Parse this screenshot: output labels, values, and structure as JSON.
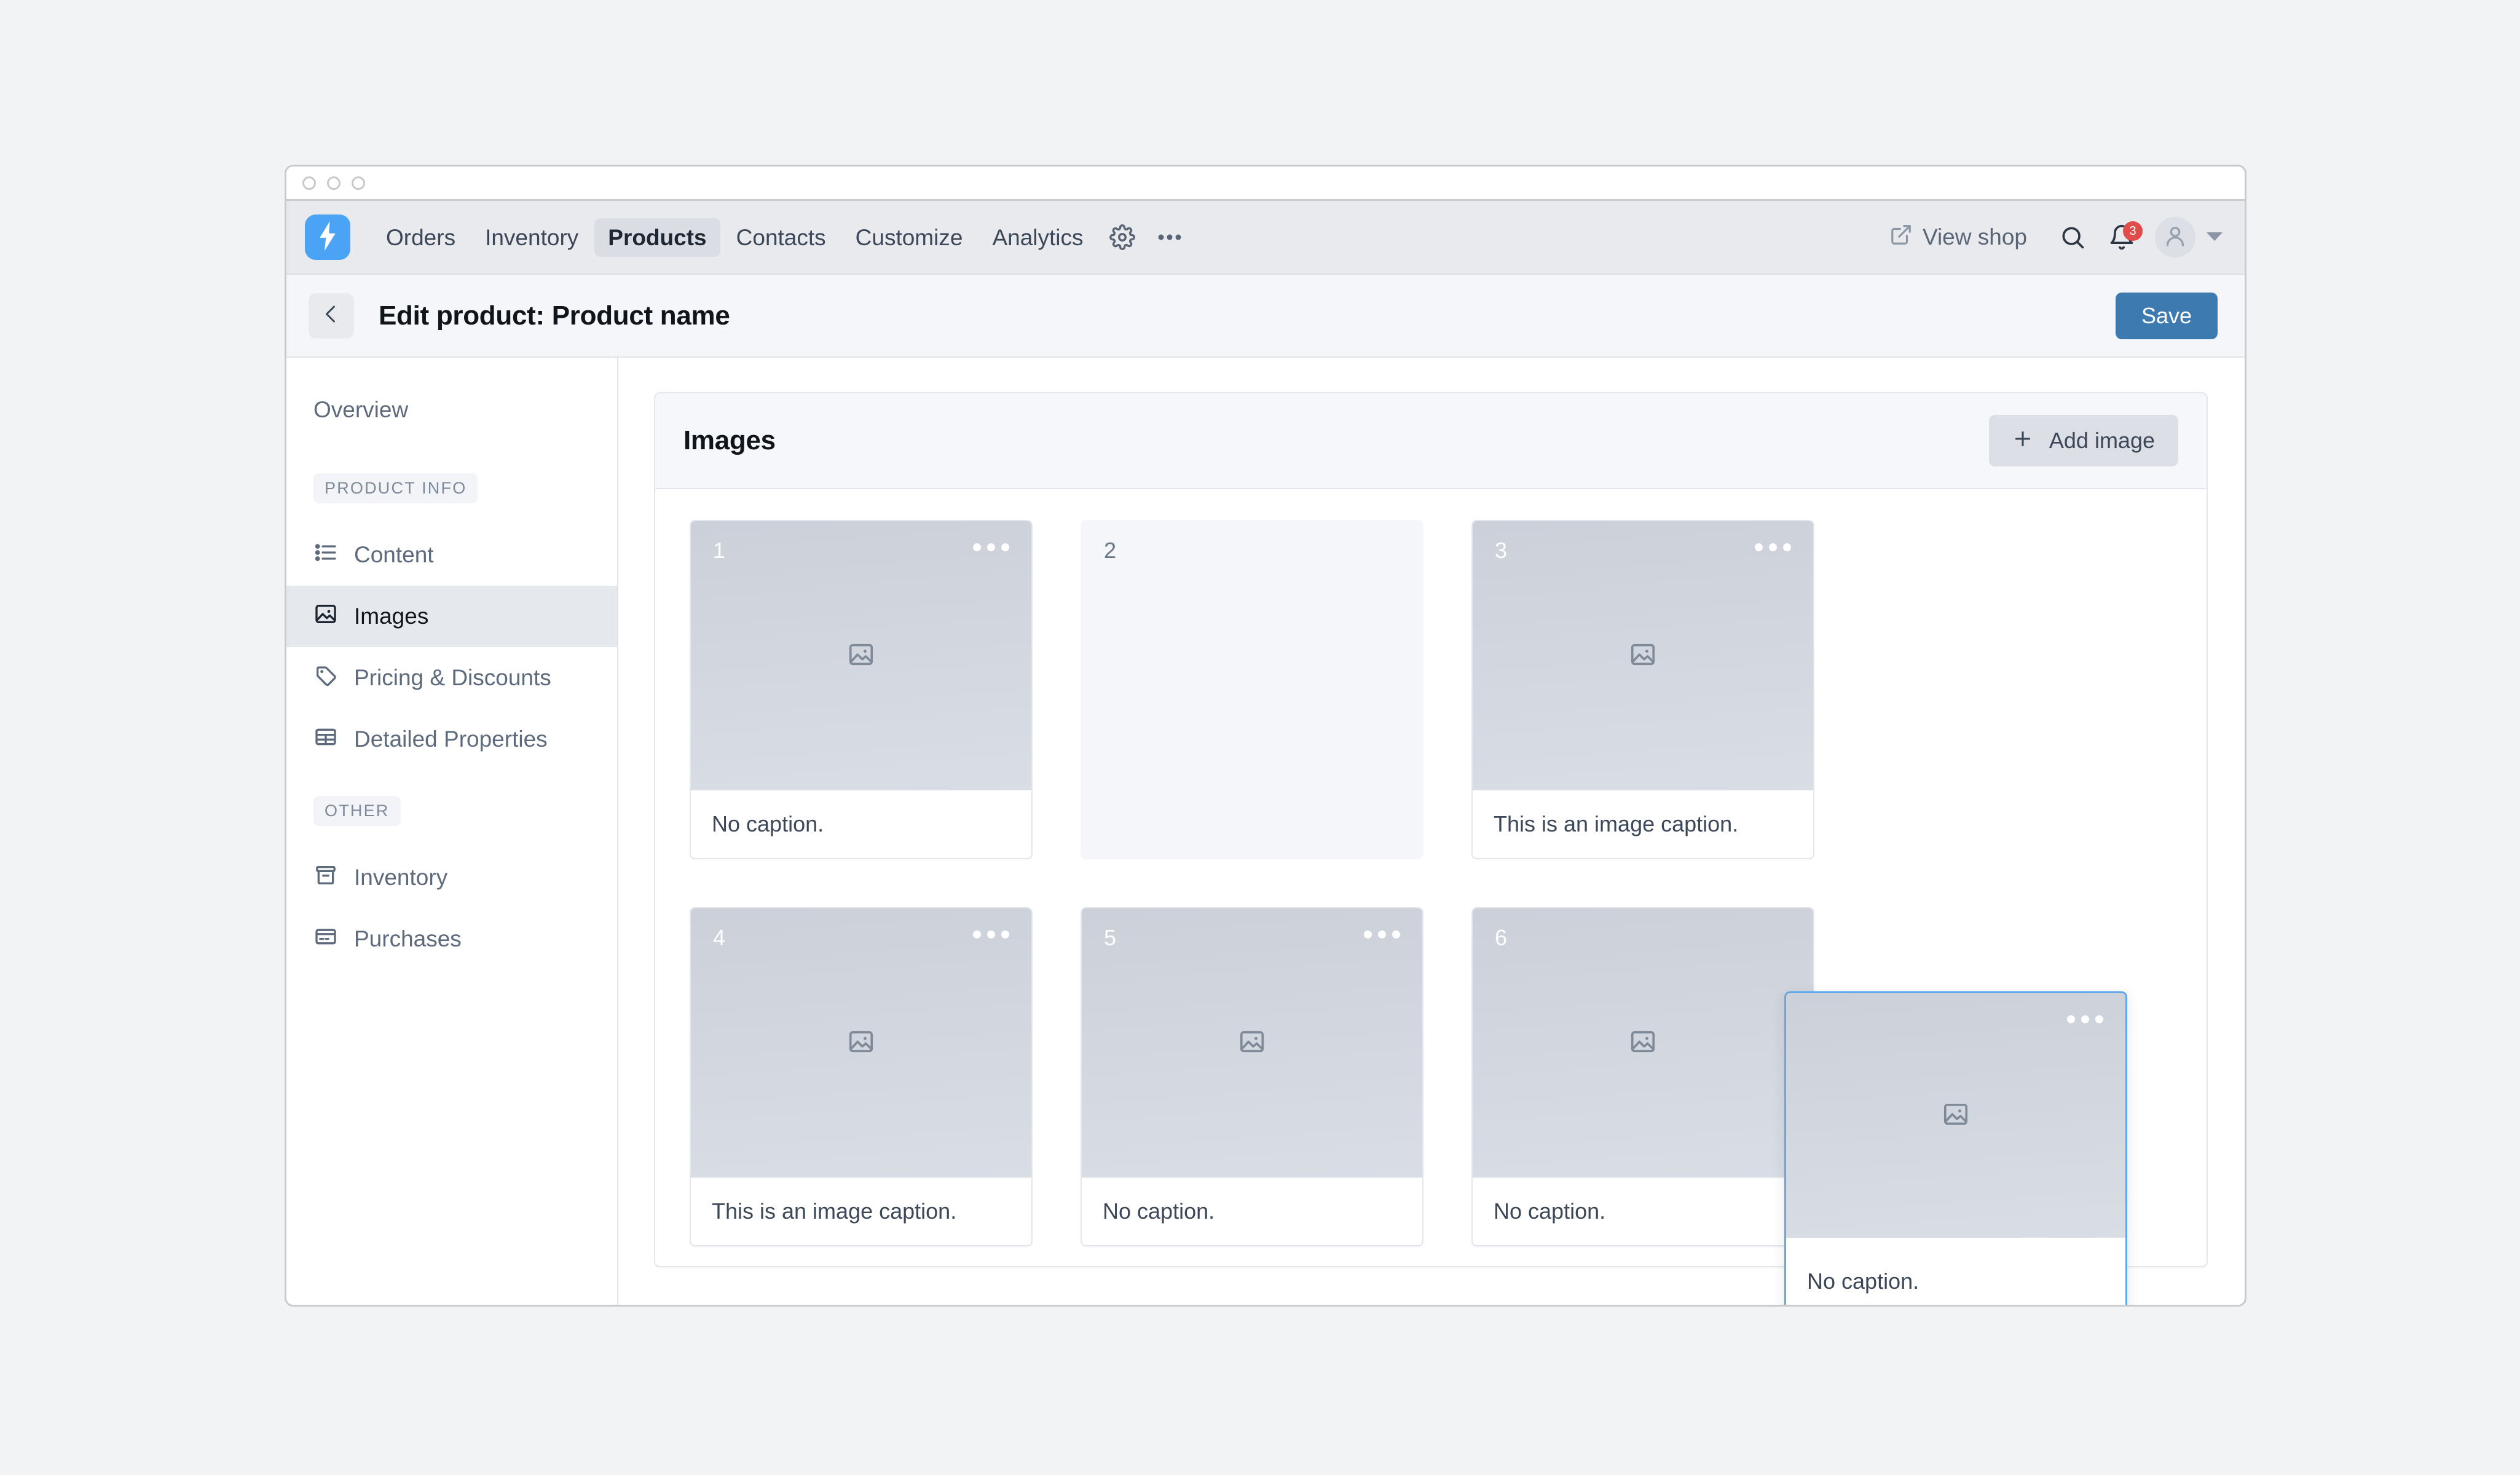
{
  "window": {
    "traffic_lights": [
      "close",
      "minimize",
      "maximize"
    ]
  },
  "topnav": {
    "logo_icon": "lightning-bolt-logo",
    "links": [
      {
        "label": "Orders",
        "active": false
      },
      {
        "label": "Inventory",
        "active": false
      },
      {
        "label": "Products",
        "active": true
      },
      {
        "label": "Contacts",
        "active": false
      },
      {
        "label": "Customize",
        "active": false
      },
      {
        "label": "Analytics",
        "active": false
      }
    ],
    "settings_icon": "gear-icon",
    "overflow_icon": "ellipsis-icon",
    "view_shop_label": "View shop",
    "view_shop_icon": "external-link-icon",
    "search_icon": "search-icon",
    "notifications_icon": "bell-icon",
    "notifications_count": "3",
    "avatar_icon": "user-avatar-icon",
    "caret_icon": "chevron-down-icon"
  },
  "pageheader": {
    "back_icon": "chevron-left-icon",
    "title": "Edit product: Product name",
    "save_label": "Save"
  },
  "sidebar": {
    "overview_label": "Overview",
    "groups": [
      {
        "label": "PRODUCT INFO",
        "items": [
          {
            "label": "Content",
            "icon": "list-icon",
            "active": false
          },
          {
            "label": "Images",
            "icon": "image-icon",
            "active": true
          },
          {
            "label": "Pricing & Discounts",
            "icon": "tag-icon",
            "active": false
          },
          {
            "label": "Detailed Properties",
            "icon": "table-icon",
            "active": false
          }
        ]
      },
      {
        "label": "OTHER",
        "items": [
          {
            "label": "Inventory",
            "icon": "archive-box-icon",
            "active": false
          },
          {
            "label": "Purchases",
            "icon": "credit-card-icon",
            "active": false
          }
        ]
      }
    ]
  },
  "panel": {
    "title": "Images",
    "add_button_label": "Add image",
    "add_button_icon": "plus-icon",
    "cards": [
      {
        "number": "1",
        "caption": "No caption.",
        "empty": false,
        "menu_icon": "ellipsis-icon"
      },
      {
        "number": "2",
        "caption": "",
        "empty": true,
        "menu_icon": ""
      },
      {
        "number": "3",
        "caption": "This is an image caption.",
        "empty": false,
        "menu_icon": "ellipsis-icon"
      },
      {
        "number": "4",
        "caption": "This is an image caption.",
        "empty": false,
        "menu_icon": "ellipsis-icon"
      },
      {
        "number": "5",
        "caption": "No caption.",
        "empty": false,
        "menu_icon": "ellipsis-icon"
      },
      {
        "number": "6",
        "caption": "No caption.",
        "empty": false,
        "menu_icon": "ellipsis-icon"
      }
    ],
    "drag_card": {
      "caption": "No caption.",
      "menu_icon": "ellipsis-icon",
      "placeholder_icon": "image-placeholder-icon"
    },
    "thumb_placeholder_icon": "image-placeholder-icon"
  },
  "colors": {
    "accent_blue": "#4ba3f5",
    "save_blue": "#3d7ab0",
    "drag_outline": "#5fa8ec",
    "badge_red": "#e04b4b"
  }
}
